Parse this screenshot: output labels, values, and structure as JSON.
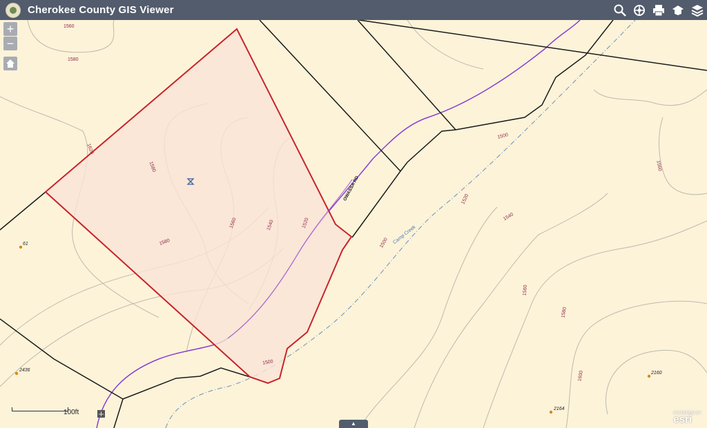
{
  "app": {
    "title": "Cherokee County GIS Viewer"
  },
  "toolbar": {
    "icons": [
      "search-icon",
      "identify-icon",
      "print-icon",
      "measure-icon",
      "layers-icon"
    ]
  },
  "map_controls": {
    "zoom_in": "+",
    "zoom_out": "−",
    "home_icon": "home-icon"
  },
  "scale": {
    "label": "100ft"
  },
  "road_label": "OWASSA RD",
  "creek_label": "Camp Creek",
  "contour_labels": [
    "1560",
    "1580",
    "1620",
    "1580",
    "1580",
    "1560",
    "1540",
    "1520",
    "1500",
    "1500",
    "1520",
    "1540",
    "1560",
    "1560",
    "1580",
    "1600",
    "1500"
  ],
  "parcel_labels": [
    "61",
    "2436",
    "2160",
    "2164"
  ],
  "attribution": {
    "powered": "POWERED BY",
    "brand": "esri"
  },
  "colors": {
    "header": "#525c6c",
    "map_bg": "#fdf3d9",
    "parcel_fill": "#f9e3d6",
    "parcel_outline": "#c8232c",
    "road": "#7a2fc9",
    "creek": "#4a7bb3",
    "contour": "#b8b5a9",
    "contour_label": "#8c2a4e"
  }
}
